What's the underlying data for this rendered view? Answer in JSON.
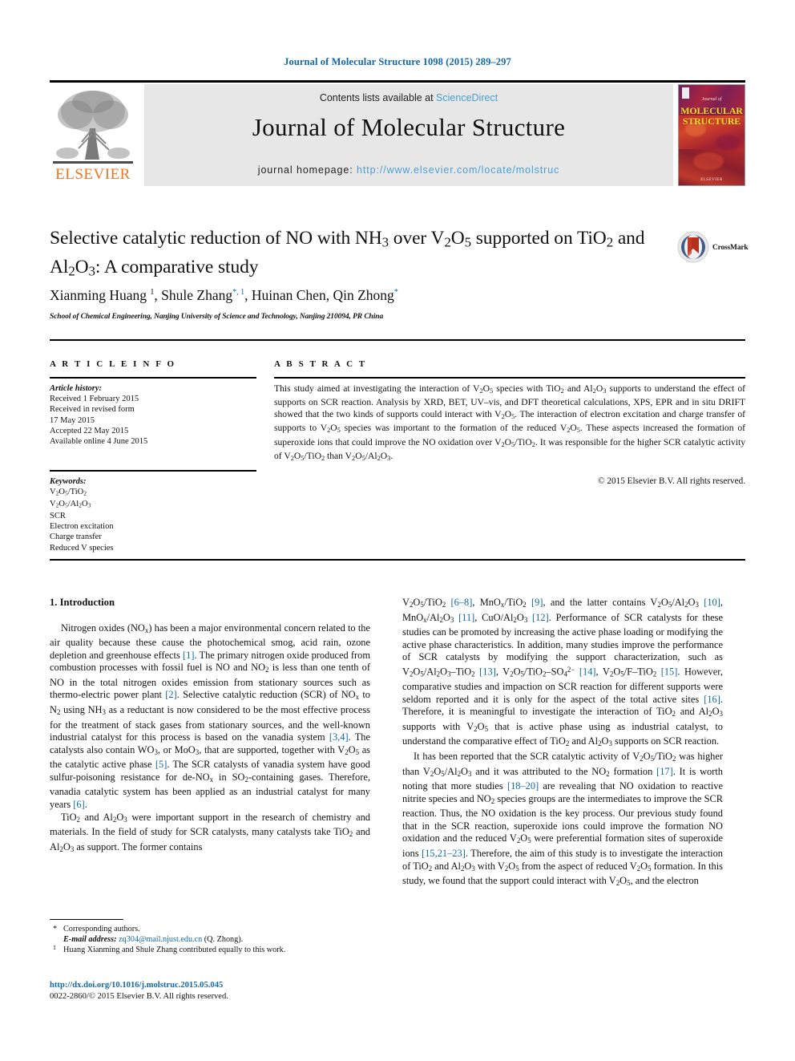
{
  "running_head": "Journal of Molecular Structure 1098 (2015) 289–297",
  "masthead": {
    "contents_prefix": "Contents lists available at ",
    "contents_link": "ScienceDirect",
    "journal_name": "Journal of Molecular Structure",
    "homepage_prefix": "journal homepage: ",
    "homepage_url": "http://www.elsevier.com/locate/molstruc",
    "publisher": "ELSEVIER",
    "cover": {
      "kicker": "Journal of",
      "title_line1": "MOLECULAR",
      "title_line2": "STRUCTURE",
      "brand": "ELSEVIER"
    }
  },
  "article": {
    "title_html": "Selective catalytic reduction of NO with NH<sub>3</sub> over V<sub>2</sub>O<sub>5</sub> supported on TiO<sub>2</sub> and Al<sub>2</sub>O<sub>3</sub>: A comparative study",
    "authors_html": "Xianming Huang <sup>1</sup>, Shule Zhang<sup class=\"star\">*, 1</sup>, Huinan Chen, Qin Zhong<sup class=\"star\">*</sup>",
    "affiliation": "School of Chemical Engineering, Nanjing University of Science and Technology, Nanjing 210094, PR China",
    "crossmark_label": "CrossMark"
  },
  "article_info": {
    "heading": "A R T I C L E   I N F O",
    "history_label": "Article history:",
    "history": [
      "Received 1 February 2015",
      "Received in revised form",
      "17 May 2015",
      "Accepted 22 May 2015",
      "Available online 4 June 2015"
    ],
    "keywords_label": "Keywords:",
    "keywords_html": [
      "V<sub>2</sub>O<sub>5</sub>/TiO<sub>2</sub>",
      "V<sub>2</sub>O<sub>5</sub>/Al<sub>2</sub>O<sub>3</sub>",
      "SCR",
      "Electron excitation",
      "Charge transfer",
      "Reduced V species"
    ]
  },
  "abstract": {
    "heading": "A B S T R A C T",
    "text_html": "This study aimed at investigating the interaction of V<sub>2</sub>O<sub>5</sub> species with TiO<sub>2</sub> and Al<sub>2</sub>O<sub>3</sub> supports to understand the effect of supports on SCR reaction. Analysis by XRD, BET, UV–vis, and DFT theoretical calculations, XPS, EPR and in situ DRIFT showed that the two kinds of supports could interact with V<sub>2</sub>O<sub>5</sub>. The interaction of electron excitation and charge transfer of supports to V<sub>2</sub>O<sub>5</sub> species was important to the formation of the reduced V<sub>2</sub>O<sub>5</sub>. These aspects increased the formation of superoxide ions that could improve the NO oxidation over V<sub>2</sub>O<sub>5</sub>/TiO<sub>2</sub>. It was responsible for the higher SCR catalytic activity of V<sub>2</sub>O<sub>5</sub>/TiO<sub>2</sub> than V<sub>2</sub>O<sub>5</sub>/Al<sub>2</sub>O<sub>3</sub>.",
    "copyright": "© 2015 Elsevier B.V. All rights reserved."
  },
  "body": {
    "section_number_title": "1.  Introduction",
    "left_paragraphs_html": [
      "Nitrogen oxides (NO<sub>x</sub>) has been a major environmental concern related to the air quality because these cause the photochemical smog, acid rain, ozone depletion and greenhouse effects <span class=\"ref\">[1]</span>. The primary nitrogen oxide produced from combustion processes with fossil fuel is NO and NO<sub>2</sub> is less than one tenth of NO in the total nitrogen oxides emission from stationary sources such as thermo-electric power plant <span class=\"ref\">[2]</span>. Selective catalytic reduction (SCR) of NO<sub>x</sub> to N<sub>2</sub> using NH<sub>3</sub> as a reductant is now considered to be the most effective process for the treatment of stack gases from stationary sources, and the well-known industrial catalyst for this process is based on the vanadia system <span class=\"ref\">[3,4]</span>. The catalysts also contain WO<sub>3</sub>, or MoO<sub>3</sub>, that are supported, together with V<sub>2</sub>O<sub>5</sub> as the catalytic active phase <span class=\"ref\">[5]</span>. The SCR catalysts of vanadia system have good sulfur-poisoning resistance for de-NO<sub>x</sub> in SO<sub>2</sub>-containing gases. Therefore, vanadia catalytic system has been applied as an industrial catalyst for many years <span class=\"ref\">[6]</span>.",
      "TiO<sub>2</sub> and Al<sub>2</sub>O<sub>3</sub> were important support in the research of chemistry and materials. In the field of study for SCR catalysts, many catalysts take TiO<sub>2</sub> and Al<sub>2</sub>O<sub>3</sub> as support. The former contains"
    ],
    "right_paragraphs_html": [
      "V<sub>2</sub>O<sub>5</sub>/TiO<sub>2</sub> <span class=\"ref\">[6–8]</span>, MnO<sub>x</sub>/TiO<sub>2</sub> <span class=\"ref\">[9]</span>, and the latter contains V<sub>2</sub>O<sub>5</sub>/Al<sub>2</sub>O<sub>3</sub> <span class=\"ref\">[10]</span>, MnO<sub>x</sub>/Al<sub>2</sub>O<sub>3</sub> <span class=\"ref\">[11]</span>, CuO/Al<sub>2</sub>O<sub>3</sub> <span class=\"ref\">[12]</span>. Performance of SCR catalysts for these studies can be promoted by increasing the active phase loading or modifying the active phase characteristics. In addition, many studies improve the performance of SCR catalysts by modifying the support characterization, such as V<sub>2</sub>O<sub>5</sub>/Al<sub>2</sub>O<sub>3</sub>–TiO<sub>2</sub> <span class=\"ref\">[13]</span>, V<sub>2</sub>O<sub>5</sub>/TiO<sub>2</sub>–SO<sub>4</sub><sup>2−</sup> <span class=\"ref\">[14]</span>, V<sub>2</sub>O<sub>5</sub>/F–TiO<sub>2</sub> <span class=\"ref\">[15]</span>. However, comparative studies and impaction on SCR reaction for different supports were seldom reported and it is only for the aspect of the total active sites <span class=\"ref\">[16]</span>. Therefore, it is meaningful to investigate the interaction of TiO<sub>2</sub> and Al<sub>2</sub>O<sub>3</sub> supports with V<sub>2</sub>O<sub>5</sub> that is active phase using as industrial catalyst, to understand the comparative effect of TiO<sub>2</sub> and Al<sub>2</sub>O<sub>3</sub> supports on SCR reaction.",
      "It has been reported that the SCR catalytic activity of V<sub>2</sub>O<sub>5</sub>/TiO<sub>2</sub> was higher than V<sub>2</sub>O<sub>5</sub>/Al<sub>2</sub>O<sub>3</sub> and it was attributed to the NO<sub>2</sub> formation <span class=\"ref\">[17]</span>. It is worth noting that more studies <span class=\"ref\">[18–20]</span> are revealing that NO oxidation to reactive nitrite species and NO<sub>2</sub> species groups are the intermediates to improve the SCR reaction. Thus, the NO oxidation is the key process. Our previous study found that in the SCR reaction, superoxide ions could improve the formation NO oxidation and the reduced V<sub>2</sub>O<sub>5</sub> were preferential formation sites of superoxide ions <span class=\"ref\">[15,21–23]</span>. Therefore, the aim of this study is to investigate the interaction of TiO<sub>2</sub> and Al<sub>2</sub>O<sub>3</sub> with V<sub>2</sub>O<sub>5</sub> from the aspect of reduced V<sub>2</sub>O<sub>5</sub> formation. In this study, we found that the support could interact with V<sub>2</sub>O<sub>5</sub>, and the electron"
    ]
  },
  "footnotes": {
    "corresponding_mark": "*",
    "corresponding_text": "Corresponding authors.",
    "email_label": "E-mail address:",
    "email": "zq304@mail.njust.edu.cn",
    "email_suffix": "(Q. Zhong).",
    "note_mark": "1",
    "note_text": "Huang Xianming and Shule Zhang contributed equally to this work."
  },
  "doi_block": {
    "doi_url": "http://dx.doi.org/10.1016/j.molstruc.2015.05.045",
    "issn_line": "0022-2860/© 2015 Elsevier B.V. All rights reserved."
  },
  "colors": {
    "link_blue": "#1268a8",
    "light_blue": "#4a9fd4",
    "elsevier_orange": "#e87722",
    "band_gray": "#e7e7e7"
  }
}
